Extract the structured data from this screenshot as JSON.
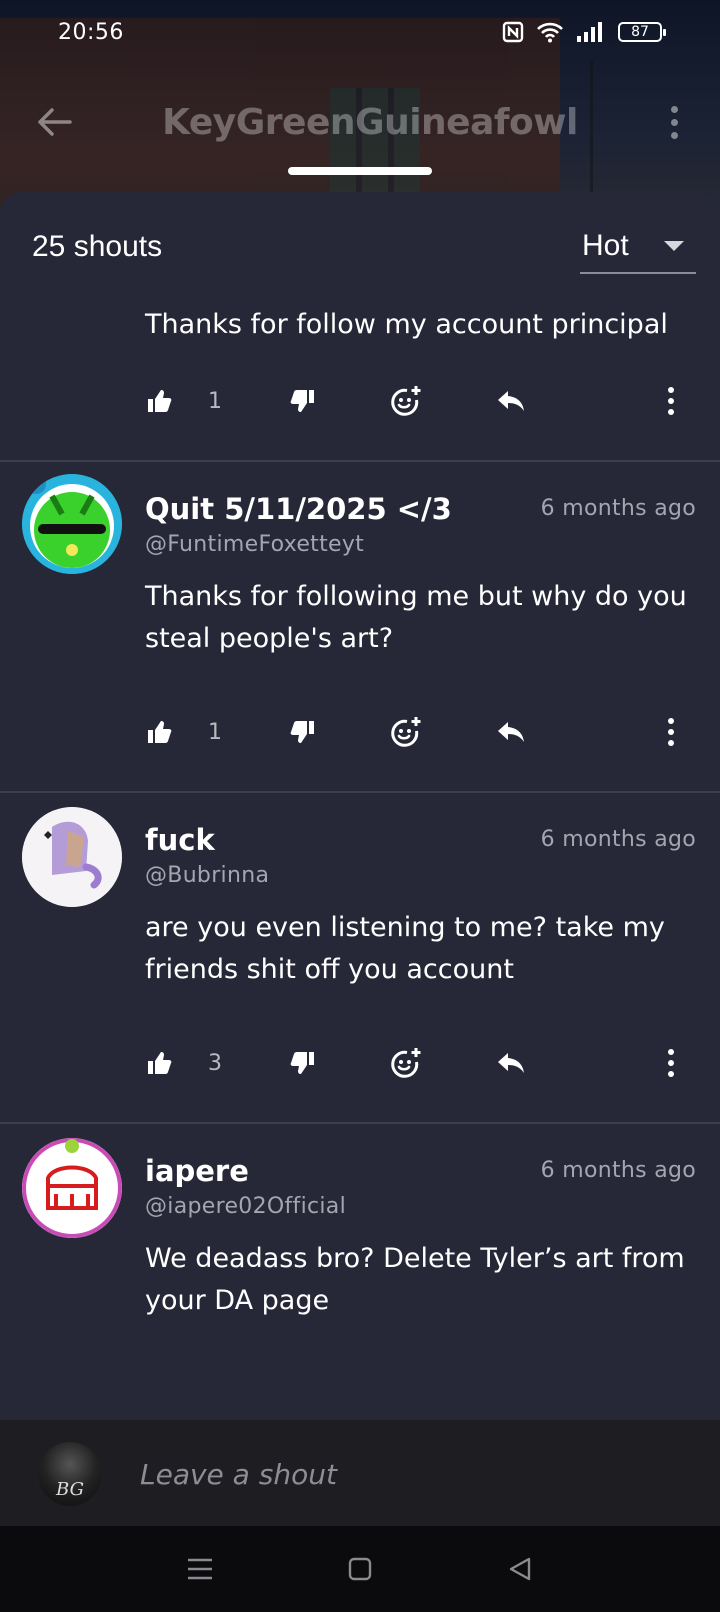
{
  "status_bar": {
    "time": "20:56",
    "battery": "87"
  },
  "profile": {
    "title": "KeyGreenGuineafowl"
  },
  "sheet": {
    "shout_count": "25 shouts",
    "sort": {
      "selected": "Hot"
    }
  },
  "shouts": [
    {
      "author": "",
      "handle": "",
      "time": "",
      "text": "Thanks for follow my account principal",
      "likes": "1"
    },
    {
      "author": "Quit 5/11/2025 </3",
      "handle": "@FuntimeFoxetteyt",
      "time": "6 months ago",
      "text": "Thanks for following me but why do you steal people's art?",
      "likes": "1"
    },
    {
      "author": "fuck",
      "handle": "@Bubrinna",
      "time": "6 months ago",
      "text": "are you even listening to me? take my friends shit off you account",
      "likes": "3"
    },
    {
      "author": "iapere",
      "handle": "@iapere02Official",
      "time": "6 months ago",
      "text": "We deadass bro? Delete Tyler’s art from your DA page",
      "likes": ""
    }
  ],
  "composer": {
    "placeholder": "Leave a shout",
    "avatar_initials": "BG"
  },
  "icons": {
    "like": "thumbs-up-icon",
    "dislike": "thumbs-down-icon",
    "react": "add-reaction-icon",
    "reply": "reply-icon",
    "more": "more-vertical-icon"
  },
  "colors": {
    "sheet_bg": "#272837",
    "page_bg": "#1b1d2b",
    "muted_text": "#a4a5b0",
    "divider": "#3d3e4c"
  }
}
